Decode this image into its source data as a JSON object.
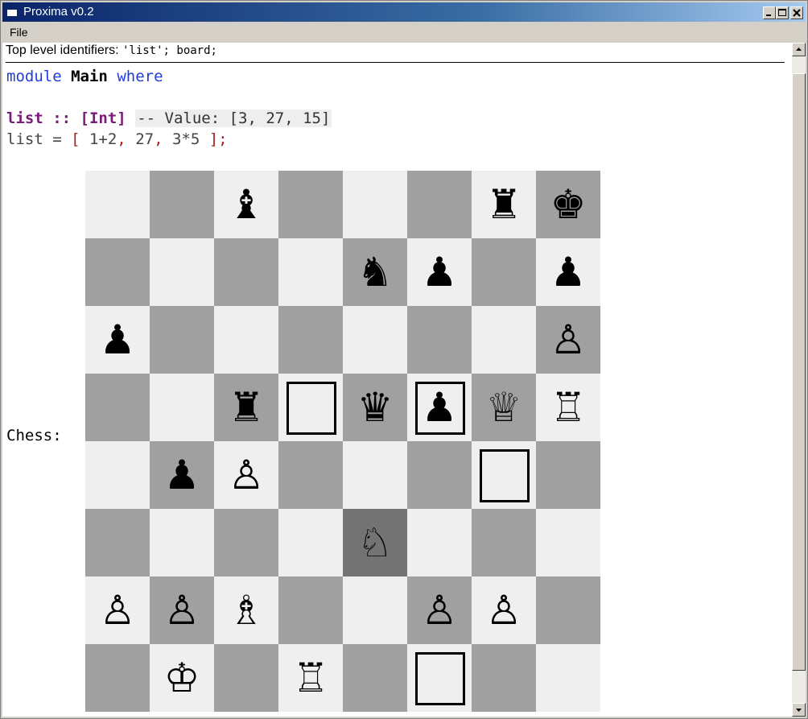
{
  "window": {
    "title": "Proxima v0.2"
  },
  "menu": {
    "items": [
      "File"
    ]
  },
  "toplevel": {
    "label": "Top level identifiers: ",
    "ids": "'list'; board;"
  },
  "code": {
    "kw_module": "module",
    "module_name": "Main",
    "kw_where": "where",
    "sig_name": "list",
    "sig_sep": " :: ",
    "sig_type": "[Int]",
    "value_comment": "-- Value: [3, 27, 15]",
    "def_lhs": "list = ",
    "def_open": "[",
    "def_e1": " 1+2",
    "def_c1": ",",
    "def_e2": " 27",
    "def_c2": ",",
    "def_e3": " 3*5 ",
    "def_close": "];"
  },
  "chess": {
    "label": "Chess:",
    "highlight": [
      5,
      4
    ],
    "markers": [
      [
        3,
        3
      ],
      [
        3,
        5
      ],
      [
        4,
        6
      ],
      [
        7,
        5
      ]
    ],
    "rows": [
      [
        "",
        "",
        "♝",
        "",
        "",
        "",
        "♜",
        "♚"
      ],
      [
        "",
        "",
        "",
        "",
        "♞",
        "♟",
        "",
        "♟"
      ],
      [
        "♟",
        "",
        "",
        "",
        "",
        "",
        "",
        "♙"
      ],
      [
        "",
        "",
        "♜",
        "",
        "♛",
        "♟",
        "♕",
        "♖"
      ],
      [
        "",
        "♟",
        "♙",
        "",
        "",
        "",
        "",
        ""
      ],
      [
        "",
        "",
        "",
        "",
        "♘",
        "",
        "",
        ""
      ],
      [
        "♙",
        "♙",
        "♗",
        "",
        "",
        "♙",
        "♙",
        ""
      ],
      [
        "",
        "♔",
        "",
        "♖",
        "",
        "",
        "",
        ""
      ]
    ]
  },
  "colors": {
    "light_square": "#efefef",
    "dark_square": "#a0a0a0",
    "highlight_square": "#737373",
    "keyword": "#1f3ddb",
    "type": "#7a1b7a",
    "bracket": "#a82020"
  }
}
